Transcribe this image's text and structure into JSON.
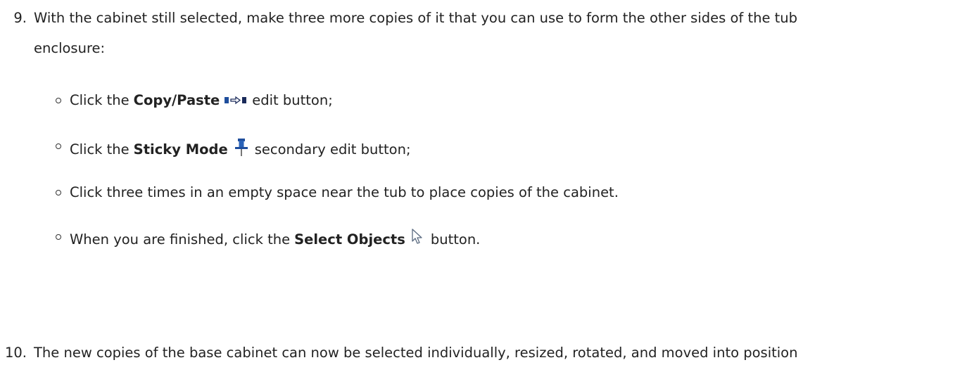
{
  "steps": [
    {
      "number": "9.",
      "text_line1": "With the cabinet still selected, make three more copies of it that you can use to form the other sides of the tub",
      "text_line2": "enclosure:",
      "substeps": [
        {
          "prefix": "Click the",
          "bold": "Copy/Paste",
          "icon": "copy-paste-icon",
          "suffix": "edit button;"
        },
        {
          "prefix": "Click the",
          "bold": "Sticky Mode",
          "icon": "sticky-mode-pin-icon",
          "suffix": "secondary edit button;"
        },
        {
          "text": "Click three times in an empty space near the tub to place copies of the cabinet."
        },
        {
          "prefix": "When you are finished, click the",
          "bold": "Select Objects",
          "icon": "select-objects-arrow-icon",
          "suffix": "button."
        }
      ]
    },
    {
      "number": "10.",
      "text_line1": "The new copies of the base cabinet can now be selected individually, resized, rotated, and moved into position"
    }
  ],
  "colors": {
    "text": "#222222",
    "icon_blue": "#1f4e9c",
    "icon_dark": "#1a2a5a"
  }
}
